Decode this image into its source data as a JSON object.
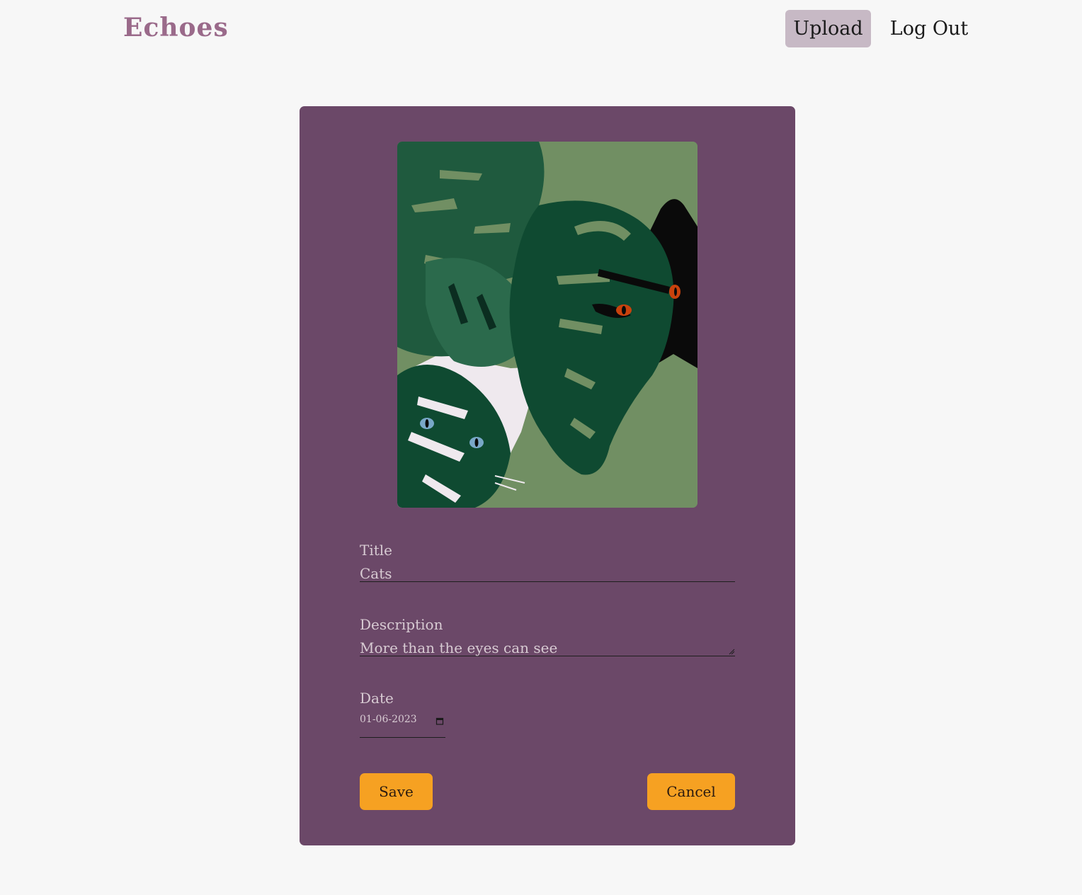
{
  "header": {
    "logo": "Echoes",
    "upload_label": "Upload",
    "logout_label": "Log Out"
  },
  "form": {
    "title_label": "Title",
    "title_value": "Cats",
    "description_label": "Description",
    "description_value": "More than the eyes can see",
    "date_label": "Date",
    "date_value": "01-06-2023",
    "save_label": "Save",
    "cancel_label": "Cancel"
  },
  "artwork": {
    "subject": "monstera leaves with black and white cats peeking through"
  },
  "colors": {
    "page_background": "#f7f7f7",
    "logo": "#9a6a8a",
    "nav_active": "#c7b9c5",
    "card": "#6b4868",
    "button": "#f6a122"
  }
}
